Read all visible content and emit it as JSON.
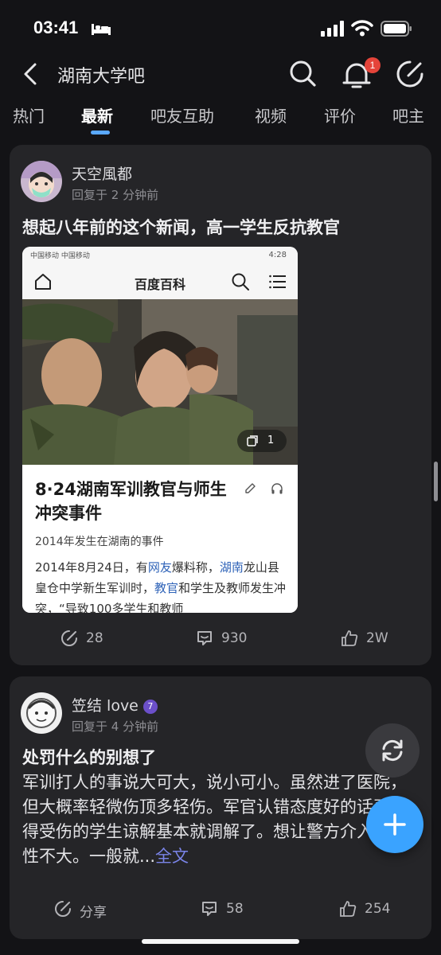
{
  "status_bar": {
    "time": "03:41"
  },
  "nav": {
    "title": "湖南大学吧",
    "notification_count": "1"
  },
  "tabs": [
    {
      "label": "热门"
    },
    {
      "label": "最新"
    },
    {
      "label": "吧友互助"
    },
    {
      "label": "视频"
    },
    {
      "label": "评价"
    },
    {
      "label": "吧主"
    }
  ],
  "active_tab": "最新",
  "posts": [
    {
      "username": "天空風都",
      "reply_time": "回复于 2 分钟前",
      "title": "想起八年前的这个新闻，高一学生反抗教官",
      "embed": {
        "status_left": "中国移动 中国移动",
        "status_right": "4:28",
        "header_title": "百度百科",
        "photo_count": "1",
        "headline": "8·24湖南军训教官与师生冲突事件",
        "subtitle": "2014年发生在湖南的事件",
        "desc_parts": [
          "2014年8月24日，有",
          "网友",
          "爆料称，",
          "湖南",
          "龙山县皇仓中学新生军训时，",
          "教官",
          "和学生及教师发生冲突，“导致100多学生和教师"
        ]
      },
      "share_count": "28",
      "comment_count": "930",
      "like_count": "2W"
    },
    {
      "username": "笠结 love",
      "reply_time": "回复于 4 分钟前",
      "title": "处罚什么的别想了",
      "body": "军训打人的事说大可大，说小可小。虽然进了医院，但大概率轻微伤顶多轻伤。军官认错态度好的话再取得受伤的学生谅解基本就调解了。想让警方介入可能性不大。一般就...",
      "more_label": "全文",
      "share_label": "分享",
      "comment_count": "58",
      "like_count": "254"
    }
  ],
  "colors": {
    "accent": "#3aa3ff",
    "badge": "#e5443a",
    "card": "#252528",
    "background": "#131316"
  }
}
